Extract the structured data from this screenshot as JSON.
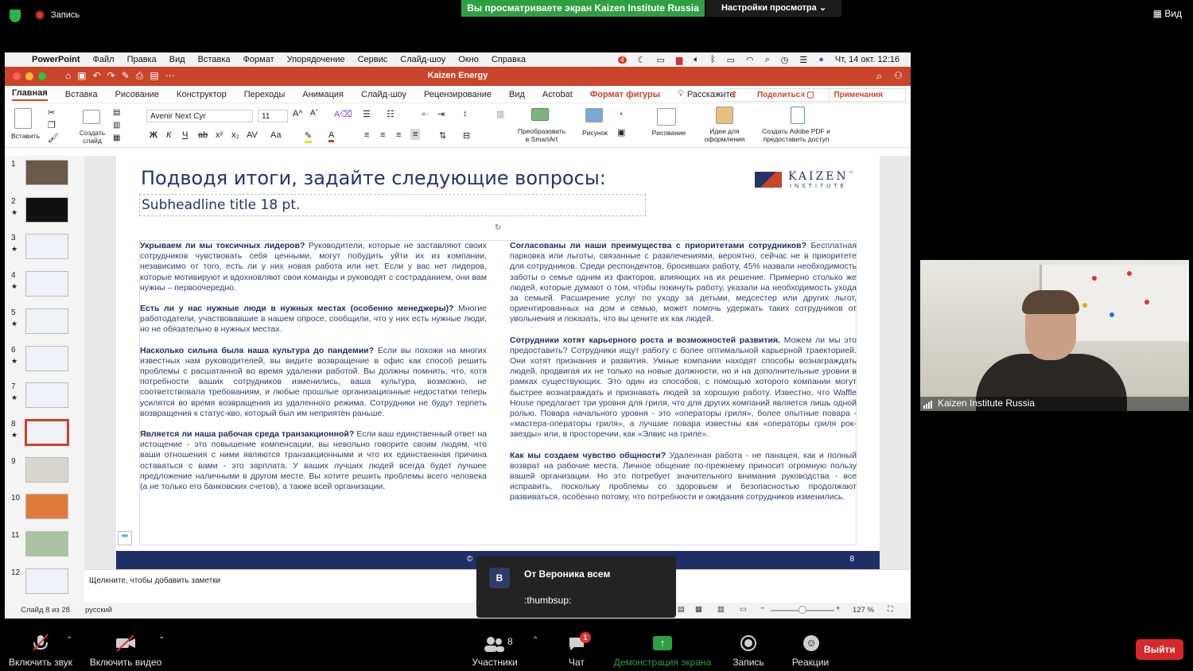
{
  "zoom_top": {
    "recording": "Запись",
    "banner": "Вы просматриваете экран Kaizen Institute Russia",
    "view_settings": "Настройки просмотра ⌄",
    "view": "Вид"
  },
  "mac_menu": {
    "app": "PowerPoint",
    "items": [
      "Файл",
      "Правка",
      "Вид",
      "Вставка",
      "Формат",
      "Упорядочение",
      "Сервис",
      "Слайд-шоу",
      "Окно",
      "Справка"
    ],
    "clock": "Чт, 14 окт.  12:16",
    "notification_count": "4"
  },
  "window": {
    "title": "Kaizen Energy"
  },
  "ribbon_tabs": [
    "Главная",
    "Вставка",
    "Рисование",
    "Конструктор",
    "Переходы",
    "Анимация",
    "Слайд-шоу",
    "Рецензирование",
    "Вид",
    "Acrobat"
  ],
  "ribbon_contextual": "Формат фигуры",
  "tell_me": "Расскажите",
  "share_label": "Поделиться",
  "notes_label": "Примечания",
  "ribbon": {
    "paste": "Вставить",
    "new_slide": "Создать\nслайд",
    "font": "Avenir Next Cyr",
    "size": "11",
    "smartart": "Преобразовать\nв SmartArt",
    "picture": "Рисунок",
    "drawing": "Рисование",
    "design_ideas": "Идеи для\nоформления",
    "adobe": "Создать Adobe PDF и\nпредоставить доступ"
  },
  "thumbnails": [
    "1",
    "2",
    "3",
    "4",
    "5",
    "6",
    "7",
    "8",
    "9",
    "10",
    "11",
    "12"
  ],
  "thumb_star": "★",
  "slide": {
    "title": "Подводя итоги, задайте следующие вопросы:",
    "logo_word": "KAIZEN",
    "logo_tm": "™",
    "logo_sub": "INSTITUTE",
    "subheadline": "Subheadline title 18 pt.",
    "left_col": [
      {
        "q": "Укрываем ли мы токсичных лидеров?",
        "t": " Руководители, которые не заставляют своих сотрудников чувствовать себя ценными, могут побудить уйти их из компании, независимо от того, есть ли у них новая работа или нет. Если у вас нет лидеров, которые мотивируют и вдохновляют свои команды и руководят с состраданием, они вам нужны – первоочередно."
      },
      {
        "q": "Есть ли у нас нужные люди в нужных местах (особенно менеджеры)?",
        "t": " Многие работодатели, участвовавшие в нашем опросе, сообщили, что у них есть нужные люди, но не обязательно в нужных местах."
      },
      {
        "q": "Насколько сильна была наша культура до пандемии?",
        "t": " Если вы похожи на многих известных нам руководителей, вы видите возвращение в офис как способ решить проблемы с расшатанной во время удаленки работой. Вы должны помнить, что, хотя потребности ваших сотрудников изменились, ваша культура, возможно, не соответствовала требованиям, и любые прошлые организационные недостатки теперь усилятся во время возвращения из удаленного режима. Сотрудники не будут терпеть возвращения к статус-кво, который был им неприятен раньше."
      },
      {
        "q": "Является ли наша рабочая среда транзакционной?",
        "t": " Если ваш единственный ответ на истощение - это повышение компенсации, вы невольно говорите своим людям, что ваши отношения с ними являются транзакционными и что их единственная причина оставаться с вами - это зарплата. У ваших лучших людей всегда будет лучшее предложение наличными в другом месте. Вы хотите решить проблемы всего человека (а не только его банковских счетов), а также всей организации."
      }
    ],
    "right_col": [
      {
        "q": "Согласованы ли наши преимущества с приоритетами сотрудников?",
        "t": " Бесплатная парковка или льготы, связанные с развлечениями, вероятно, сейчас не в приоритете для сотрудников. Среди респондентов, бросивших работу, 45% назвали необходимость заботы о семье одним из факторов, влияющих на их решение. Примерно столько же людей, которые думают о том, чтобы покинуть работу, указали на необходимость ухода за семьей. Расширение услуг по уходу за детьми, медсестер или других льгот, ориентированных на дом и семью, может помочь удержать таких сотрудников от увольнения и показать, что вы цените их как людей."
      },
      {
        "q": "Сотрудники хотят карьерного роста и возможностей развития.",
        "t": " Можем ли мы это предоставить? Сотрудники ищут работу с более оптимальной карьерной траекторией. Они хотят признания и развития. Умные компании находят способы вознаграждать людей, продвигая их не только на новые должности, но и на дополнительные уровни в рамках существующих. Это один из способов, с помощью которого компании могут быстрее вознаграждать и признавать людей за хорошую работу. Известно, что Waffle House предлагает три уровня для гриля, что для других компаний является лишь одной ролью. Повара начального уровня - это «операторы гриля», более опытные повара - «мастера-операторы гриля», а лучшие повара известны как «операторы гриля рок-звезды» или, в просторечии, как «Элвис на гриле»."
      },
      {
        "q": "Как мы создаем чувство общности?",
        "t": " Удаленная работа - не панацея, как и полный возврат на рабочие места. Личное общение по-прежнему приносит огромную пользу вашей организации. Но это потребует значительного внимания руководства - все исправить, поскольку проблемы со здоровьем и безопасностью продолжают развиваться, особенно потому, что потребности и ожидания сотрудников изменились."
      }
    ],
    "footer_copy": "©",
    "page_number": "8"
  },
  "notes_placeholder": "Щелкните, чтобы добавить заметки",
  "status": {
    "slide": "Слайд 8 из 28",
    "lang": "русский",
    "zoom": "127 %"
  },
  "chat_popup": {
    "avatar": "В",
    "from": "От Вероника всем",
    "message": ":thumbsup:"
  },
  "video": {
    "name": "Kaizen Institute Russia"
  },
  "zoom_bottom": {
    "mute": "Включить звук",
    "video": "Включить видео",
    "participants": "Участники",
    "participants_count": "8",
    "chat": "Чат",
    "chat_badge": "1",
    "share": "Демонстрация экрана",
    "record": "Запись",
    "reactions": "Реакции",
    "exit": "Выйти"
  },
  "colors": {
    "accent": "#c9442a",
    "navy": "#1f2f66",
    "zoom_green": "#2ea043",
    "exit_red": "#d9262b"
  }
}
